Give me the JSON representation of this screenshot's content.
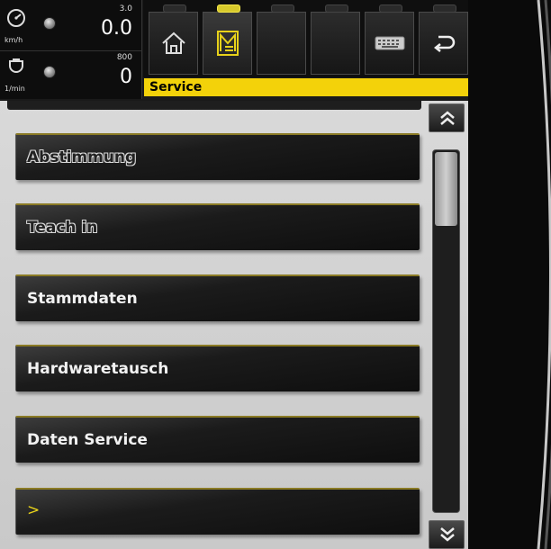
{
  "status": {
    "speed": {
      "icon": "speedometer-icon",
      "unit": "km/h",
      "max": "3.0",
      "value": "0.0"
    },
    "rpm": {
      "icon": "engine-icon",
      "unit": "1/min",
      "max": "800",
      "value": "0"
    }
  },
  "toolbar": {
    "buttons": [
      {
        "name": "home",
        "icon": "home-icon",
        "active": false
      },
      {
        "name": "menu",
        "icon": "menu-icon",
        "active": true
      },
      {
        "name": "empty-1",
        "icon": "",
        "active": false
      },
      {
        "name": "empty-2",
        "icon": "",
        "active": false
      },
      {
        "name": "keyboard",
        "icon": "keyboard-icon",
        "active": false
      },
      {
        "name": "back",
        "icon": "back-arrow-icon",
        "active": false
      }
    ]
  },
  "title": "Service",
  "menu": {
    "items": [
      {
        "label": "Abstimmung",
        "style": "outline"
      },
      {
        "label": "Teach in",
        "style": "outline"
      },
      {
        "label": "Stammdaten",
        "style": "solid"
      },
      {
        "label": "Hardwaretausch",
        "style": "solid"
      },
      {
        "label": "Daten Service",
        "style": "solid"
      },
      {
        "label": ">",
        "style": "more"
      }
    ]
  },
  "scrollbar": {
    "position": 0.0
  },
  "colors": {
    "accent_yellow": "#f3d20a",
    "background": "#d9d9d9",
    "button_dark": "#1b1b1b"
  }
}
